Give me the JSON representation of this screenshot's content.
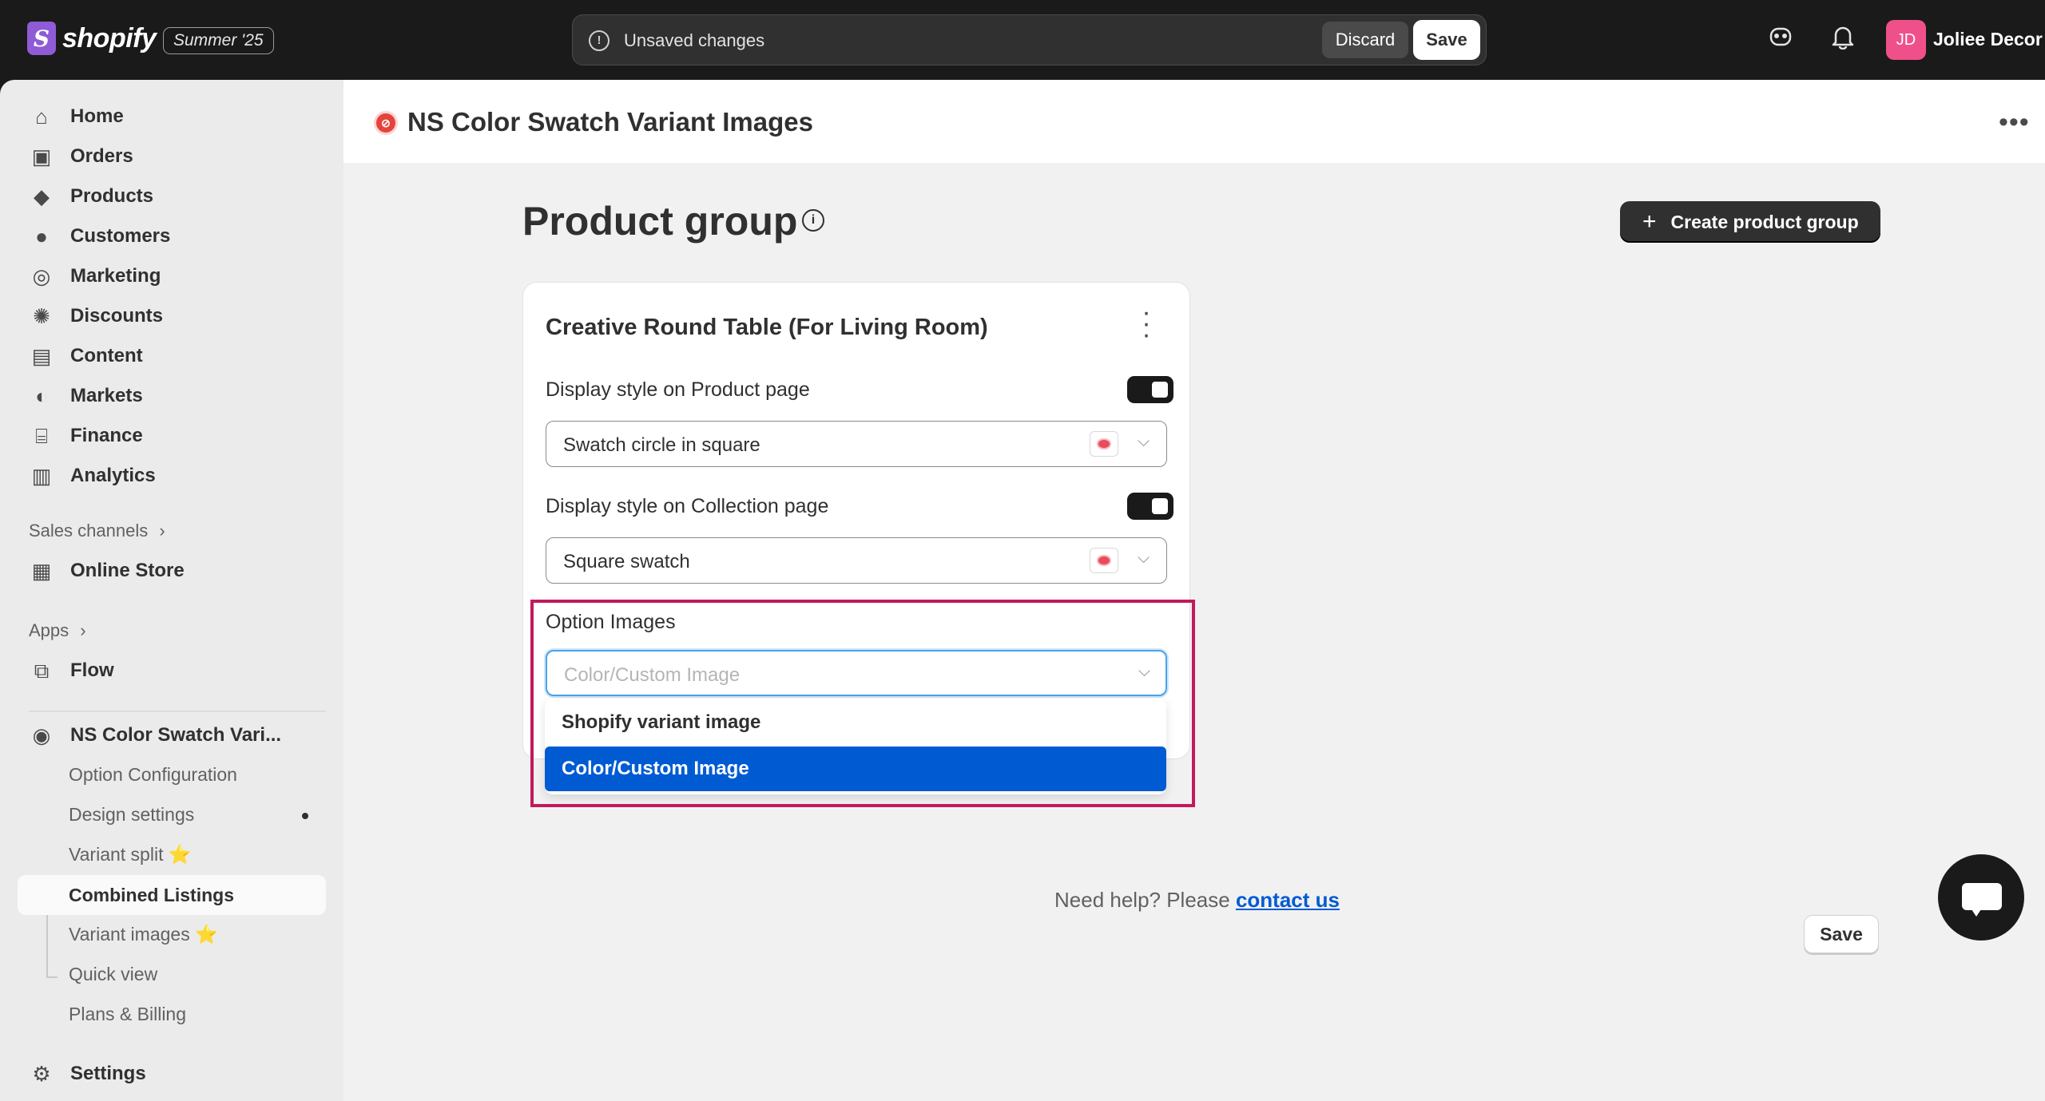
{
  "topbar": {
    "brand": "shopify",
    "edition": "Summer '25",
    "unsaved_text": "Unsaved changes",
    "discard_label": "Discard",
    "save_label": "Save",
    "avatar_initials": "JD",
    "store_name": "Joliee Decor"
  },
  "sidebar": {
    "items": [
      {
        "label": "Home",
        "icon": "home-icon"
      },
      {
        "label": "Orders",
        "icon": "inbox-icon"
      },
      {
        "label": "Products",
        "icon": "tag-icon"
      },
      {
        "label": "Customers",
        "icon": "person-icon"
      },
      {
        "label": "Marketing",
        "icon": "target-icon"
      },
      {
        "label": "Discounts",
        "icon": "discount-icon"
      },
      {
        "label": "Content",
        "icon": "content-icon"
      },
      {
        "label": "Markets",
        "icon": "globe-icon"
      },
      {
        "label": "Finance",
        "icon": "bank-icon"
      },
      {
        "label": "Analytics",
        "icon": "bar-chart-icon"
      }
    ],
    "sales_channels_label": "Sales channels",
    "online_store": "Online Store",
    "apps_label": "Apps",
    "flow": "Flow",
    "app_name": "NS Color Swatch Vari...",
    "sub_items": [
      "Option Configuration",
      "Design settings",
      "Variant split ⭐",
      "Combined Listings",
      "Variant images ⭐",
      "Quick view",
      "Plans & Billing"
    ],
    "settings": "Settings"
  },
  "header": {
    "app_title": "NS Color Swatch Variant Images"
  },
  "page": {
    "title": "Product group",
    "create_button": "Create product group"
  },
  "card": {
    "title": "Creative Round Table (For Living Room)",
    "product_page_label": "Display style on Product page",
    "product_page_value": "Swatch circle in square",
    "collection_page_label": "Display style on Collection page",
    "collection_page_value": "Square swatch",
    "option_images_label": "Option Images",
    "option_images_placeholder": "Color/Custom Image",
    "dropdown_options": [
      "Shopify variant image",
      "Color/Custom Image"
    ],
    "selected_option": "Color/Custom Image"
  },
  "footer": {
    "help_text": "Need help? Please",
    "contact_link": "contact us",
    "save_label": "Save"
  },
  "colors": {
    "accent": "#005bd3",
    "highlight": "#c21a5c",
    "brand": "#8f5bd6"
  }
}
